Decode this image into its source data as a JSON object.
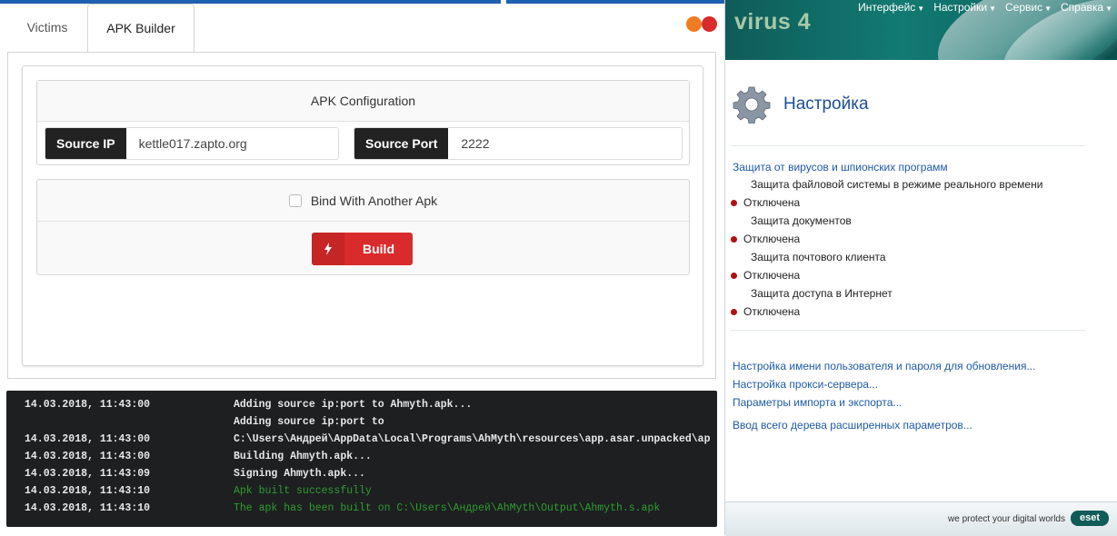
{
  "ahmyth": {
    "tabs": [
      {
        "label": "Victims"
      },
      {
        "label": "APK Builder"
      }
    ],
    "config": {
      "title": "APK Configuration",
      "source_ip_label": "Source IP",
      "source_ip_value": "kettle017.zapto.org",
      "source_port_label": "Source Port",
      "source_port_value": "2222"
    },
    "bind": {
      "label": "Bind With Another Apk",
      "checked": false
    },
    "build": {
      "icon": "bolt-icon",
      "label": "Build"
    },
    "log": [
      {
        "time": "14.03.2018, 11:43:00",
        "msg": "Adding source ip:port to Ahmyth.apk...",
        "ok": false
      },
      {
        "time": "",
        "msg": "Adding source ip:port to",
        "ok": false
      },
      {
        "time": "14.03.2018, 11:43:00",
        "msg": "C:\\Users\\Андрей\\AppData\\Local\\Programs\\AhMyth\\resources\\app.asar.unpacked\\ap",
        "ok": false
      },
      {
        "time": "14.03.2018, 11:43:00",
        "msg": "Building Ahmyth.apk...",
        "ok": false
      },
      {
        "time": "14.03.2018, 11:43:09",
        "msg": "Signing Ahmyth.apk...",
        "ok": false
      },
      {
        "time": "14.03.2018, 11:43:10",
        "msg": "Apk built successfully",
        "ok": true
      },
      {
        "time": "14.03.2018, 11:43:10",
        "msg": "The apk has been built on C:\\Users\\Андрей\\AhMyth\\Output\\Ahmyth.s.apk",
        "ok": true
      }
    ],
    "colors": {
      "accent_red": "#d92b2b",
      "accent_orange": "#f07c22",
      "console_bg": "#1d1f21",
      "success": "#2f9e2f"
    }
  },
  "eset": {
    "brand": "virus 4",
    "menu": [
      "Интерфейс",
      "Настройки",
      "Сервис",
      "Справка"
    ],
    "title": "Настройка",
    "section_link": "Защита от вирусов и шпионских программ",
    "modules": [
      {
        "name": "Защита файловой системы в режиме реального времени",
        "status": "Отключена"
      },
      {
        "name": "Защита документов",
        "status": "Отключена"
      },
      {
        "name": "Защита почтового клиента",
        "status": "Отключена"
      },
      {
        "name": "Защита доступа в Интернет",
        "status": "Отключена"
      }
    ],
    "links": [
      "Настройка имени пользователя и пароля для обновления...",
      "Настройка прокси-сервера...",
      "Параметры импорта и экспорта...",
      "Ввод всего дерева расширенных параметров..."
    ],
    "footer": {
      "slogan": "we protect your digital worlds",
      "logo": "eset"
    },
    "colors": {
      "header": "#0f5c59",
      "link": "#1f5aa8",
      "status_dot": "#b01010"
    }
  }
}
